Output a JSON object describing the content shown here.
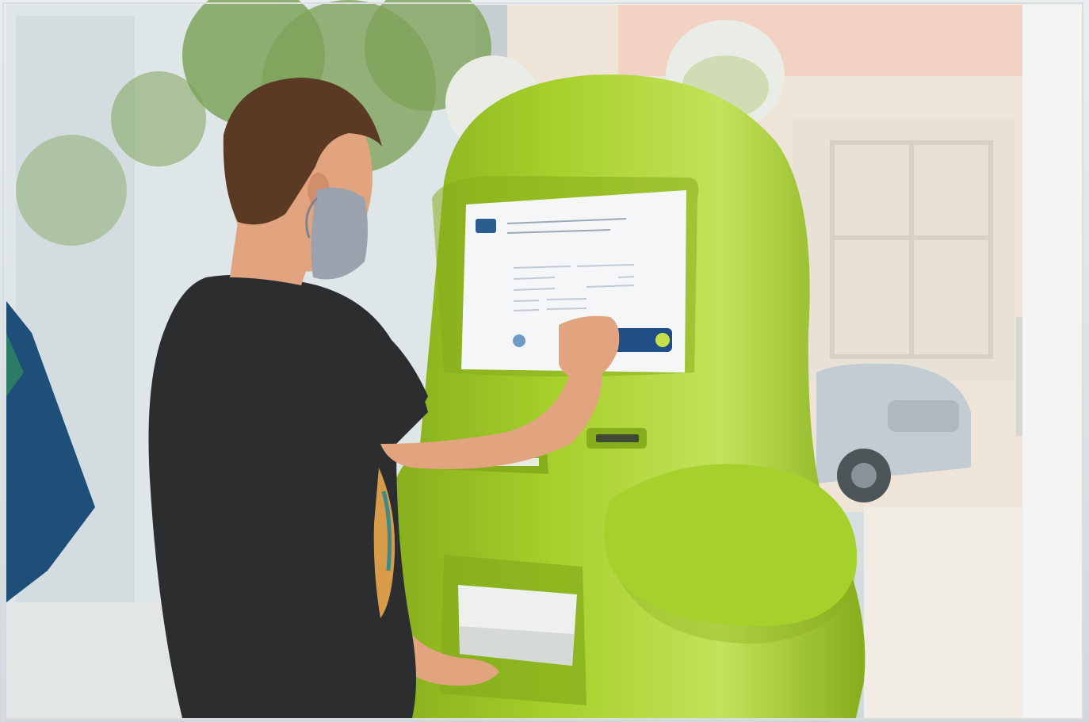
{
  "scene": {
    "colors": {
      "kiosk_body": "#a6d02b",
      "kiosk_shadow": "#86ad1c",
      "kiosk_highlight": "#c3e25a",
      "ears": "#e9ede6",
      "screen": "#f4f6f8",
      "screen_button": "#1f4f86",
      "shirt": "#2c2d2f",
      "hair": "#5a3a22",
      "skin": "#e1a47f",
      "mask": "#9aa3ad",
      "window_blue": "#1e4f78",
      "street_wall": "#efe4d8",
      "foliage": "#7ea35a"
    }
  }
}
